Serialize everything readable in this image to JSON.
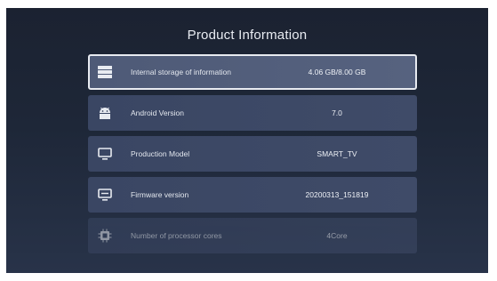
{
  "title": "Product Information",
  "items": [
    {
      "icon": "storage-icon",
      "label": "Internal storage of information",
      "value": "4.06 GB/8.00 GB"
    },
    {
      "icon": "android-icon",
      "label": "Android Version",
      "value": "7.0"
    },
    {
      "icon": "monitor-icon",
      "label": "Production Model",
      "value": "SMART_TV"
    },
    {
      "icon": "firmware-icon",
      "label": "Firmware version",
      "value": "20200313_151819"
    },
    {
      "icon": "processor-icon",
      "label": "Number of processor cores",
      "value": "4Core"
    }
  ]
}
